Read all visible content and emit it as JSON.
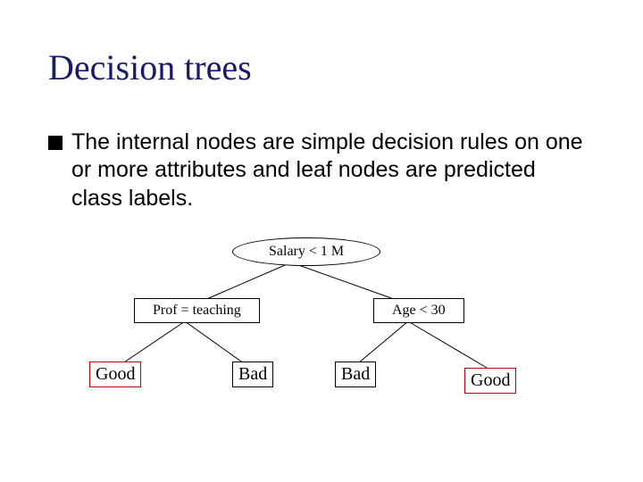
{
  "title": "Decision trees",
  "bullet": "The internal nodes are simple decision rules on one or more attributes and leaf nodes are predicted class labels.",
  "tree": {
    "root": "Salary < 1 M",
    "left_node": "Prof = teaching",
    "right_node": "Age < 30",
    "leaf_ll": "Good",
    "leaf_lr": "Bad",
    "leaf_rl": "Bad",
    "leaf_rr": "Good"
  }
}
